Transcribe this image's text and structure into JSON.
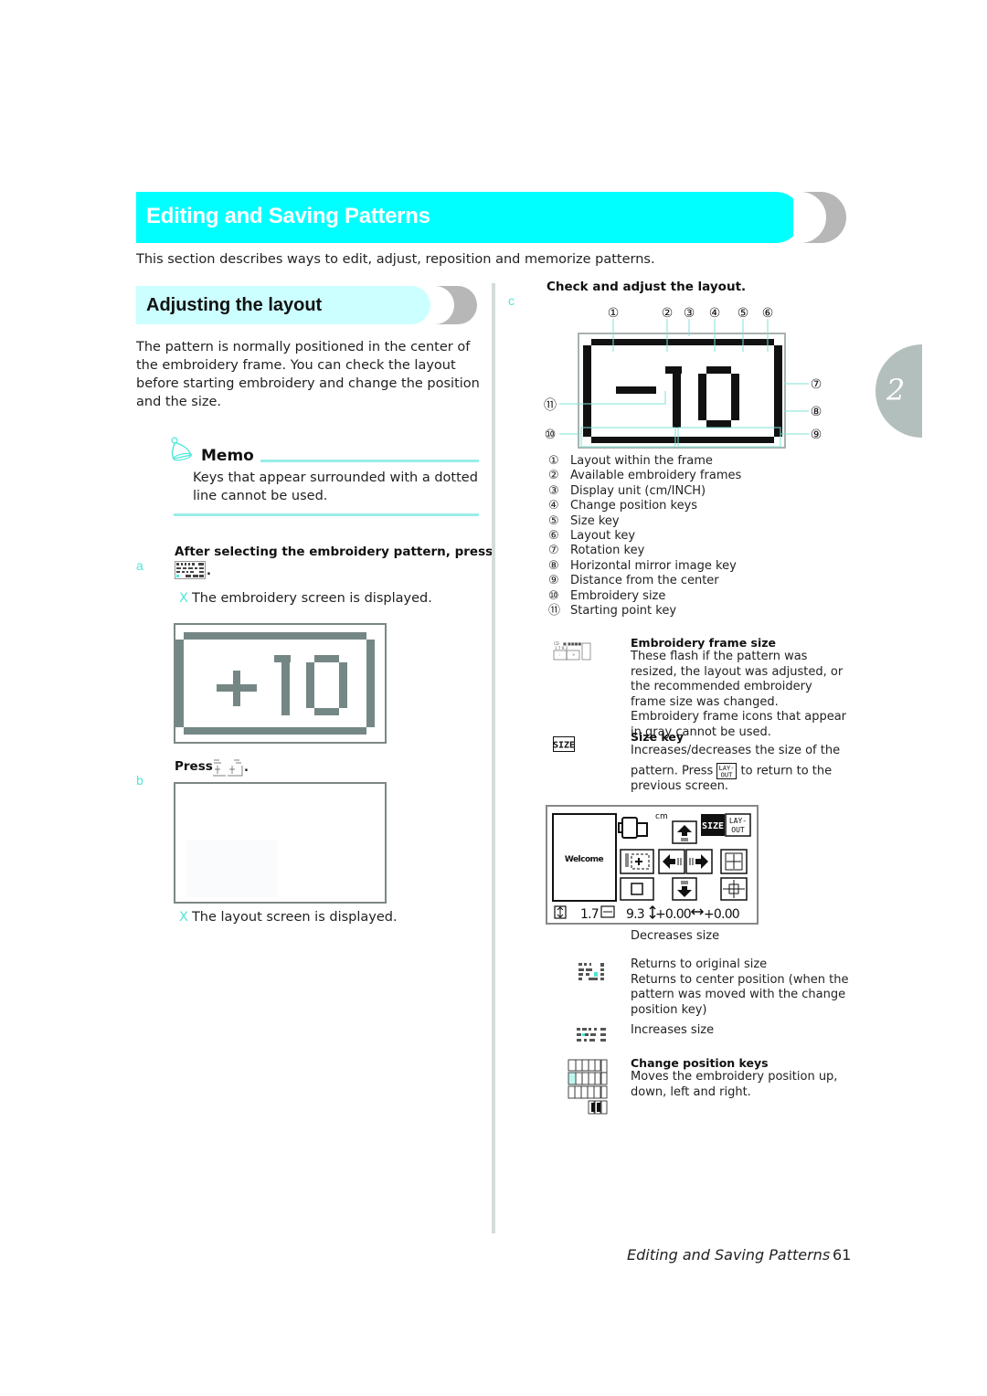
{
  "header": {
    "section_title": "Editing and Saving Patterns",
    "intro": "This section describes ways to edit, adjust, reposition and memorize patterns.",
    "accent_color": "#00ffff",
    "sub_accent_color": "#ccffff"
  },
  "subsection": {
    "title": "Adjusting the layout",
    "paragraph": "The pattern is normally positioned in the center of the embroidery frame. You can check the layout before starting embroidery and change the position and the size."
  },
  "memo": {
    "title": "Memo",
    "icon": "bell-icon",
    "text": "Keys that appear surrounded with a dotted line cannot be used."
  },
  "steps": [
    {
      "letter": "a",
      "heading": "After selecting the embroidery pattern, press",
      "key_icon": "embroidery-key-icon",
      "trailing": ".",
      "result_mark": "X",
      "result": "The embroidery screen is displayed.",
      "screen_text": "+10"
    },
    {
      "letter": "b",
      "heading": "Press",
      "key_icon": "layout-key-icon",
      "trailing": ".",
      "result_mark": "X",
      "result": "The layout screen is displayed."
    },
    {
      "letter": "c",
      "heading": "Check and adjust the layout.",
      "screen_text": "-10"
    }
  ],
  "callouts": {
    "top": [
      "①",
      "②",
      "③",
      "④",
      "⑤",
      "⑥"
    ],
    "right": [
      "⑦",
      "⑧",
      "⑨"
    ],
    "left": [
      "⑪",
      "⑩"
    ]
  },
  "legend": [
    {
      "num": "①",
      "label": "Layout within the frame"
    },
    {
      "num": "②",
      "label": "Available embroidery frames"
    },
    {
      "num": "③",
      "label": "Display unit (cm/INCH)"
    },
    {
      "num": "④",
      "label": "Change position keys"
    },
    {
      "num": "⑤",
      "label": "Size key"
    },
    {
      "num": "⑥",
      "label": "Layout key"
    },
    {
      "num": "⑦",
      "label": "Rotation key"
    },
    {
      "num": "⑧",
      "label": "Horizontal mirror image key"
    },
    {
      "num": "⑨",
      "label": "Distance from the center"
    },
    {
      "num": "⑩",
      "label": "Embroidery size"
    },
    {
      "num": "⑪",
      "label": "Starting point key"
    }
  ],
  "descriptions": {
    "frame_size": {
      "title": "Embroidery frame size",
      "text": "These flash if the pattern was resized, the layout was adjusted, or the recommended embroidery frame size was changed. Embroidery frame icons that appear in gray cannot be used."
    },
    "size_key": {
      "title": "Size key",
      "icon_label": "SIZE",
      "text1": "Increases/decreases the size of the",
      "text2_pre": "pattern. Press",
      "inline_icon_label_top": "LAY-",
      "inline_icon_label_bottom": "OUT",
      "text2_post": "to return to the",
      "text3": "previous screen."
    },
    "decreases": "Decreases size",
    "original": {
      "line1": "Returns to original size",
      "line2": "Returns to center position (when the pattern was moved with the change position key)"
    },
    "increases": "Increases size",
    "change_position": {
      "title": "Change position keys",
      "text": "Moves the embroidery position up, down, left and right."
    }
  },
  "size_screen": {
    "pattern_text": "Welcome",
    "unit": "cm",
    "size_label": "SIZE",
    "layout_label_top": "LAY-",
    "layout_label_bottom": "OUT",
    "height_value": "1.7",
    "width_value": "9.3",
    "vertical_offset": "+0.00",
    "horizontal_offset": "+0.00"
  },
  "chapter": {
    "number": "2"
  },
  "footer": {
    "title": "Editing and Saving Patterns",
    "page": "61"
  }
}
